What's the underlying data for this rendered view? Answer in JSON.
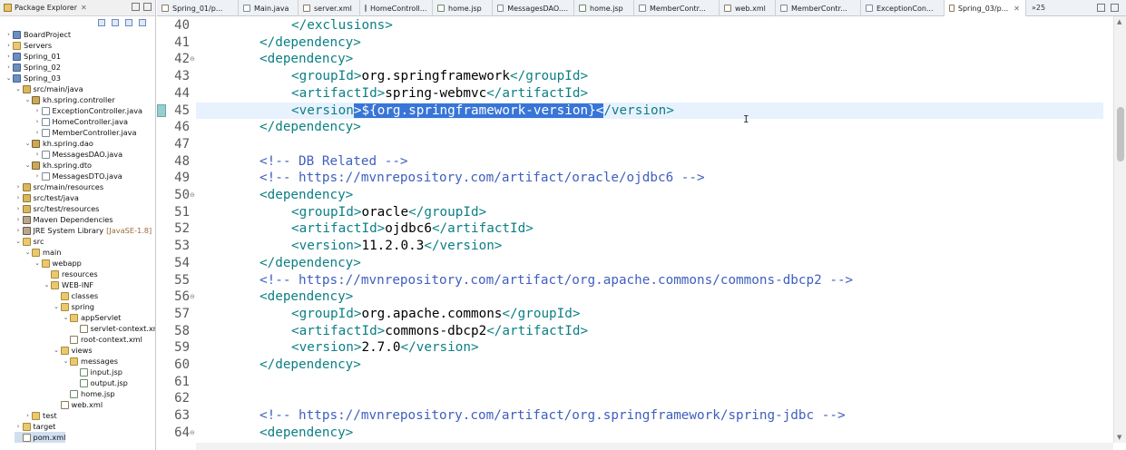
{
  "explorer": {
    "title": "Package Explorer",
    "close": "✕",
    "tree": [
      {
        "label": "BoardProject",
        "depth": 0,
        "expand": "›",
        "icon": "project"
      },
      {
        "label": "Servers",
        "depth": 0,
        "expand": "›",
        "icon": "folder"
      },
      {
        "label": "Spring_01",
        "depth": 0,
        "expand": "›",
        "icon": "project"
      },
      {
        "label": "Spring_02",
        "depth": 0,
        "expand": "›",
        "icon": "project"
      },
      {
        "label": "Spring_03",
        "depth": 0,
        "expand": "⌄",
        "icon": "project"
      },
      {
        "label": "src/main/java",
        "depth": 1,
        "expand": "⌄",
        "icon": "srcfolder"
      },
      {
        "label": "kh.spring.controller",
        "depth": 2,
        "expand": "⌄",
        "icon": "package"
      },
      {
        "label": "ExceptionController.java",
        "depth": 3,
        "expand": "›",
        "icon": "java"
      },
      {
        "label": "HomeController.java",
        "depth": 3,
        "expand": "›",
        "icon": "java"
      },
      {
        "label": "MemberController.java",
        "depth": 3,
        "expand": "›",
        "icon": "java"
      },
      {
        "label": "kh.spring.dao",
        "depth": 2,
        "expand": "⌄",
        "icon": "package"
      },
      {
        "label": "MessagesDAO.java",
        "depth": 3,
        "expand": "›",
        "icon": "java"
      },
      {
        "label": "kh.spring.dto",
        "depth": 2,
        "expand": "⌄",
        "icon": "package"
      },
      {
        "label": "MessagesDTO.java",
        "depth": 3,
        "expand": "›",
        "icon": "java"
      },
      {
        "label": "src/main/resources",
        "depth": 1,
        "expand": "›",
        "icon": "srcfolder"
      },
      {
        "label": "src/test/java",
        "depth": 1,
        "expand": "›",
        "icon": "srcfolder"
      },
      {
        "label": "src/test/resources",
        "depth": 1,
        "expand": "›",
        "icon": "srcfolder"
      },
      {
        "label": "Maven Dependencies",
        "depth": 1,
        "expand": "›",
        "icon": "lib"
      },
      {
        "label": "JRE System Library",
        "depth": 1,
        "expand": "›",
        "icon": "lib",
        "extra": "[JavaSE-1.8]"
      },
      {
        "label": "src",
        "depth": 1,
        "expand": "⌄",
        "icon": "folder"
      },
      {
        "label": "main",
        "depth": 2,
        "expand": "⌄",
        "icon": "folder"
      },
      {
        "label": "webapp",
        "depth": 3,
        "expand": "⌄",
        "icon": "folder"
      },
      {
        "label": "resources",
        "depth": 4,
        "expand": "",
        "icon": "folder"
      },
      {
        "label": "WEB-INF",
        "depth": 4,
        "expand": "⌄",
        "icon": "folder"
      },
      {
        "label": "classes",
        "depth": 5,
        "expand": "",
        "icon": "folder"
      },
      {
        "label": "spring",
        "depth": 5,
        "expand": "⌄",
        "icon": "folder"
      },
      {
        "label": "appServlet",
        "depth": 6,
        "expand": "⌄",
        "icon": "folder"
      },
      {
        "label": "servlet-context.xm",
        "depth": 7,
        "expand": "",
        "icon": "xml"
      },
      {
        "label": "root-context.xml",
        "depth": 6,
        "expand": "",
        "icon": "xml"
      },
      {
        "label": "views",
        "depth": 5,
        "expand": "⌄",
        "icon": "folder"
      },
      {
        "label": "messages",
        "depth": 6,
        "expand": "⌄",
        "icon": "folder"
      },
      {
        "label": "input.jsp",
        "depth": 7,
        "expand": "",
        "icon": "jsp"
      },
      {
        "label": "output.jsp",
        "depth": 7,
        "expand": "",
        "icon": "jsp"
      },
      {
        "label": "home.jsp",
        "depth": 6,
        "expand": "",
        "icon": "jsp"
      },
      {
        "label": "web.xml",
        "depth": 5,
        "expand": "",
        "icon": "xml"
      },
      {
        "label": "test",
        "depth": 2,
        "expand": "›",
        "icon": "folder"
      },
      {
        "label": "target",
        "depth": 1,
        "expand": "›",
        "icon": "folder"
      },
      {
        "label": "pom.xml",
        "depth": 1,
        "expand": "",
        "icon": "xml",
        "selected": true
      }
    ]
  },
  "editor": {
    "tabs": [
      {
        "label": "Spring_01/p...",
        "icon": "xml"
      },
      {
        "label": "Main.java",
        "icon": "java"
      },
      {
        "label": "server.xml",
        "icon": "xml"
      },
      {
        "label": "HomeControll...",
        "icon": "java"
      },
      {
        "label": "home.jsp",
        "icon": "jsp"
      },
      {
        "label": "MessagesDAO....",
        "icon": "java"
      },
      {
        "label": "home.jsp",
        "icon": "jsp"
      },
      {
        "label": "MemberContr...",
        "icon": "java"
      },
      {
        "label": "web.xml",
        "icon": "xml"
      },
      {
        "label": "MemberContr...",
        "icon": "java"
      },
      {
        "label": "ExceptionCon...",
        "icon": "java"
      },
      {
        "label": "Spring_03/p...",
        "icon": "xml",
        "active": true
      }
    ],
    "tab_close": "✕",
    "overflow": "»25",
    "lines": [
      {
        "num": "40",
        "indent": 2,
        "parts": [
          [
            "tag",
            "</exclusions>"
          ]
        ]
      },
      {
        "num": "41",
        "indent": 1,
        "parts": [
          [
            "tag",
            "</dependency>"
          ]
        ]
      },
      {
        "num": "42",
        "fold": true,
        "indent": 1,
        "parts": [
          [
            "tag",
            "<dependency>"
          ]
        ]
      },
      {
        "num": "43",
        "indent": 2,
        "parts": [
          [
            "tag",
            "<groupId>"
          ],
          [
            "txt",
            "org.springframework"
          ],
          [
            "tag",
            "</groupId>"
          ]
        ]
      },
      {
        "num": "44",
        "indent": 2,
        "parts": [
          [
            "tag",
            "<artifactId>"
          ],
          [
            "txt",
            "spring-webmvc"
          ],
          [
            "tag",
            "</artifactId>"
          ]
        ]
      },
      {
        "num": "45",
        "current": true,
        "marker": true,
        "indent": 2,
        "parts": [
          [
            "tag",
            "<version"
          ],
          [
            "sel",
            ">${org.springframework-version}<"
          ],
          [
            "tag",
            "/version>"
          ]
        ]
      },
      {
        "num": "46",
        "indent": 1,
        "parts": [
          [
            "tag",
            "</dependency>"
          ]
        ]
      },
      {
        "num": "47",
        "indent": 0,
        "parts": []
      },
      {
        "num": "48",
        "indent": 1,
        "parts": [
          [
            "cmt",
            "<!-- DB Related -->"
          ]
        ]
      },
      {
        "num": "49",
        "indent": 1,
        "parts": [
          [
            "cmt",
            "<!-- https://mvnrepository.com/artifact/oracle/ojdbc6 -->"
          ]
        ]
      },
      {
        "num": "50",
        "fold": true,
        "indent": 1,
        "parts": [
          [
            "tag",
            "<dependency>"
          ]
        ]
      },
      {
        "num": "51",
        "indent": 2,
        "parts": [
          [
            "tag",
            "<groupId>"
          ],
          [
            "txt",
            "oracle"
          ],
          [
            "tag",
            "</groupId>"
          ]
        ]
      },
      {
        "num": "52",
        "indent": 2,
        "parts": [
          [
            "tag",
            "<artifactId>"
          ],
          [
            "txt",
            "ojdbc6"
          ],
          [
            "tag",
            "</artifactId>"
          ]
        ]
      },
      {
        "num": "53",
        "indent": 2,
        "parts": [
          [
            "tag",
            "<version>"
          ],
          [
            "txt",
            "11.2.0.3"
          ],
          [
            "tag",
            "</version>"
          ]
        ]
      },
      {
        "num": "54",
        "indent": 1,
        "parts": [
          [
            "tag",
            "</dependency>"
          ]
        ]
      },
      {
        "num": "55",
        "indent": 1,
        "parts": [
          [
            "cmt",
            "<!-- https://mvnrepository.com/artifact/org.apache.commons/commons-dbcp2 -->"
          ]
        ]
      },
      {
        "num": "56",
        "fold": true,
        "indent": 1,
        "parts": [
          [
            "tag",
            "<dependency>"
          ]
        ]
      },
      {
        "num": "57",
        "indent": 2,
        "parts": [
          [
            "tag",
            "<groupId>"
          ],
          [
            "txt",
            "org.apache.commons"
          ],
          [
            "tag",
            "</groupId>"
          ]
        ]
      },
      {
        "num": "58",
        "indent": 2,
        "parts": [
          [
            "tag",
            "<artifactId>"
          ],
          [
            "txt",
            "commons-dbcp2"
          ],
          [
            "tag",
            "</artifactId>"
          ]
        ]
      },
      {
        "num": "59",
        "indent": 2,
        "parts": [
          [
            "tag",
            "<version>"
          ],
          [
            "txt",
            "2.7.0"
          ],
          [
            "tag",
            "</version>"
          ]
        ]
      },
      {
        "num": "60",
        "indent": 1,
        "parts": [
          [
            "tag",
            "</dependency>"
          ]
        ]
      },
      {
        "num": "61",
        "indent": 0,
        "parts": []
      },
      {
        "num": "62",
        "indent": 0,
        "parts": []
      },
      {
        "num": "63",
        "indent": 1,
        "parts": [
          [
            "cmt",
            "<!-- https://mvnrepository.com/artifact/org.springframework/spring-jdbc -->"
          ]
        ]
      },
      {
        "num": "64",
        "fold": true,
        "indent": 1,
        "parts": [
          [
            "tag",
            "<dependency>"
          ]
        ]
      }
    ]
  },
  "colors": {
    "tag": "#0c7f84",
    "comment": "#3f5fbf",
    "selection": "#3875d7",
    "current_line": "#e8f2fe"
  }
}
